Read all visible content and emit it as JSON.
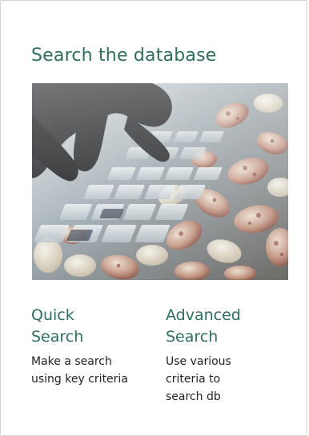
{
  "header": {
    "title": "Search the database"
  },
  "image": {
    "icon": "keyboard-with-beans-photo"
  },
  "options": [
    {
      "title_line1": "Quick",
      "title_line2": "Search",
      "desc_line1": "Make a search",
      "desc_line2": "using key criteria"
    },
    {
      "title_line1": "Advanced",
      "title_line2": "Search",
      "desc_line1": "Use various",
      "desc_line2": "criteria to",
      "desc_line3": "search db"
    }
  ],
  "colors": {
    "heading": "#2c6e60",
    "text": "#222222",
    "border": "#d4d4d4"
  }
}
